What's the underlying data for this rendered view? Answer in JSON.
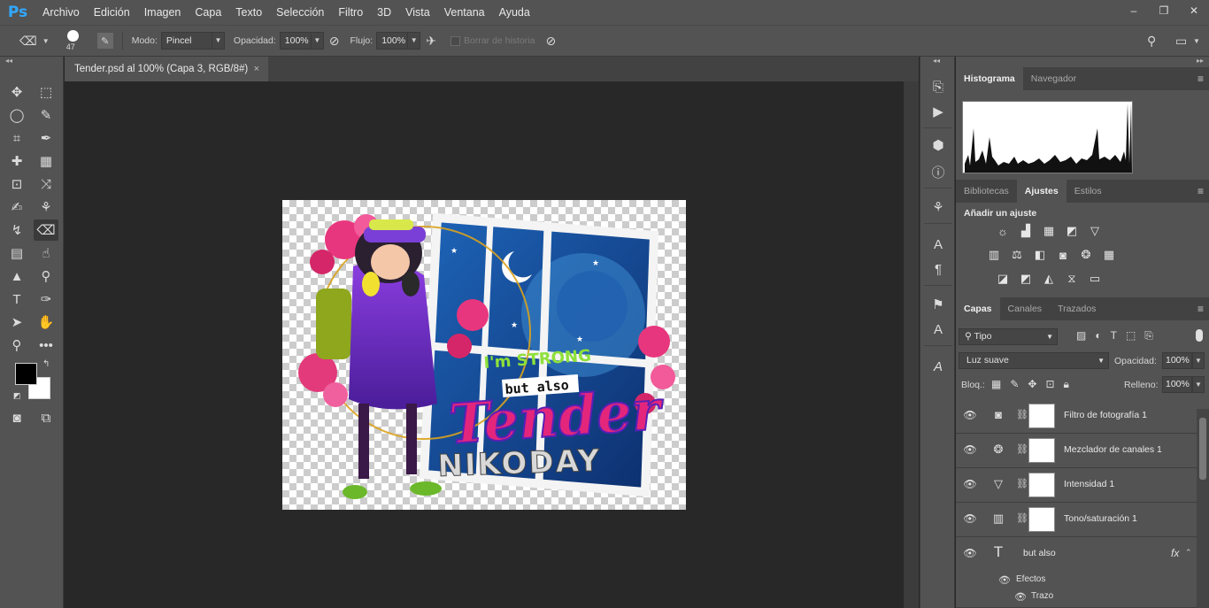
{
  "app": {
    "logo": "Ps",
    "menu": [
      "Archivo",
      "Edición",
      "Imagen",
      "Capa",
      "Texto",
      "Selección",
      "Filtro",
      "3D",
      "Vista",
      "Ventana",
      "Ayuda"
    ],
    "window_controls": {
      "minimize": "–",
      "restore": "❐",
      "close": "✕"
    }
  },
  "options_bar": {
    "brush_size": "47",
    "mode_label": "Modo:",
    "mode_value": "Pincel",
    "opacity_label": "Opacidad:",
    "opacity_value": "100%",
    "flow_label": "Flujo:",
    "flow_value": "100%",
    "erase_history_label": "Borrar de historia"
  },
  "document": {
    "tab_title": "Tender.psd al 100% (Capa 3, RGB/8#)",
    "close": "×",
    "artwork": {
      "line1": "I'm STRONG",
      "line2": "but also",
      "line3": "Tender",
      "line4": "NIKODAY"
    }
  },
  "panels": {
    "top_tabs": {
      "histogram": "Histograma",
      "navigator": "Navegador"
    },
    "middle_tabs": {
      "libraries": "Bibliotecas",
      "adjustments": "Ajustes",
      "styles": "Estilos"
    },
    "add_adjustment": "Añadir un ajuste",
    "layers_tabs": {
      "layers": "Capas",
      "channels": "Canales",
      "paths": "Trazados"
    },
    "filter_kind": "Tipo",
    "blend_mode": "Luz suave",
    "opacity_label": "Opacidad:",
    "opacity_value": "100%",
    "lock_label": "Bloq.:",
    "fill_label": "Relleno:",
    "fill_value": "100%",
    "layers": [
      {
        "name": "Filtro de fotografía 1",
        "type_icon": "camera-icon"
      },
      {
        "name": "Mezclador de canales 1",
        "type_icon": "channel-mixer-icon"
      },
      {
        "name": "Intensidad 1",
        "type_icon": "vibrance-icon"
      },
      {
        "name": "Tono/saturación 1",
        "type_icon": "hue-saturation-icon"
      },
      {
        "name": "but also",
        "type_icon": "text-layer-icon"
      }
    ],
    "effects_label": "Efectos",
    "stroke_label": "Trazo",
    "fx_label": "fx"
  },
  "colors": {
    "ui_dark": "#535353",
    "canvas_bg": "#282828",
    "ps_blue": "#31a8ff",
    "art_pink": "#e3267c",
    "art_purple": "#6a2fc2",
    "art_green": "#8ee03a"
  }
}
